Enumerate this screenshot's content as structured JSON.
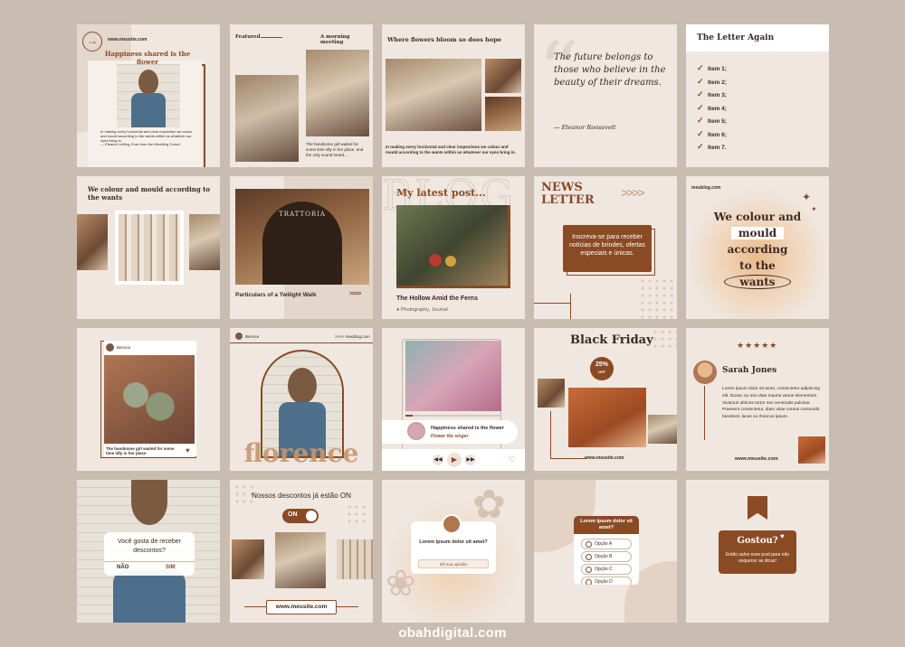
{
  "brand": {
    "footer": "obahdigital.com"
  },
  "colors": {
    "background": "#c9bdb1",
    "tile": "#efe7e0",
    "accent": "#8a4a24",
    "text": "#3a2a22"
  },
  "r1": {
    "t1": {
      "site": "www.meusite.com",
      "title": "Happiness shared is the flower",
      "quote": "In making every horizontal and clear inspection we colour and mould according to the wants within us whatever our eyes bring in.",
      "caption": "— Eleanor Leffing, Ever from the Wedding Crowd"
    },
    "t2": {
      "label": "Featured",
      "title": "A morning meeting",
      "caption": "The handsome girl waited for some time idly in her place, and the only sound heard..."
    },
    "t3": {
      "title": "Where flowers bloom so does hope",
      "quote": "In making every horizontal and clear inspections we colour and mould according to the wants within us whatever our eyes bring in."
    },
    "t4": {
      "quote": "The future belongs to those who believe in the beauty of their dreams.",
      "author": "— Eleanor Roosevelt"
    },
    "t5": {
      "title": "The Letter Again",
      "items": [
        "Item 1;",
        "Item 2;",
        "Item 3;",
        "Item 4;",
        "Item 5;",
        "Item 6;",
        "Item 7."
      ]
    }
  },
  "r2": {
    "t1": {
      "title": "We colour and mould according to the wants"
    },
    "t2": {
      "sign": "TRATTORIA",
      "title": "Particulars of a Twilight Walk",
      "arrows": ">>>>"
    },
    "t3": {
      "bg": "BLOG",
      "title": "My latest post...",
      "post": "The Hollow Amid the Ferns",
      "meta": "Photography, Journal"
    },
    "t4": {
      "title1": "NEWS",
      "title2": "LETTER",
      "arrows": ">>>>",
      "cta": "Inscreva-se para receber notícias de brindes, ofertas especiais e únicas."
    },
    "t5": {
      "site": "meublog.com",
      "l1": "We colour and",
      "l2": "mould",
      "l3": "according",
      "l4": "to the",
      "l5": "wants"
    }
  },
  "r3": {
    "t1": {
      "user": "Bernice",
      "caption": "The handsome girl waited for some time idly in her place"
    },
    "t2": {
      "user": "Bernice",
      "site": ">>>> meublog.com",
      "name": "florence"
    },
    "t3": {
      "song": "Happiness shared is the flower",
      "artist": "Flower the singer"
    },
    "t4": {
      "title": "Black Friday",
      "discount": "25%",
      "off": "OFF",
      "site": "www.meusite.com"
    },
    "t5": {
      "stars": "★★★★★",
      "name": "Sarah Jones",
      "text": "Lorem ipsum dolor sit amet, consectetur adipiscing elit. Donec eu nisi vitae mauris varius elementum. Vivamus ultrices tortor non venenatis pulvinar. Praesent consectetur, diam vitae cursus commodo hendrerit, lacus ex rhoncus ipsum.",
      "site": "www.meusite.com"
    }
  },
  "r4": {
    "t1": {
      "question": "Você gosta de receber descontos?",
      "no": "NÃO",
      "yes": "SIM"
    },
    "t2": {
      "title": "Nossos descontos já estão ON",
      "toggle": "ON",
      "site": "www.meusite.com"
    },
    "t3": {
      "question": "Lorem ipsum dolor sit amet?",
      "input": "Dê sua opinião"
    },
    "t4": {
      "question": "Lorem ipsum dolor sit amet?",
      "options": [
        "Opção A",
        "Opção B",
        "Opção C",
        "Opção D"
      ]
    },
    "t5": {
      "title": "Gostou?",
      "text": "Então salve esse post para não esquecer as dicas!"
    }
  }
}
